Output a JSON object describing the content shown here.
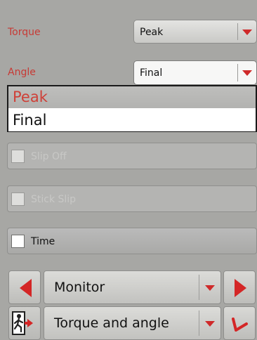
{
  "torque": {
    "label": "Torque",
    "value": "Peak"
  },
  "angle": {
    "label": "Angle",
    "value": "Final"
  },
  "angle_dropdown": {
    "options": [
      "Peak",
      "Final"
    ],
    "highlighted": "Peak"
  },
  "checkboxes": [
    {
      "label": "Slip Off",
      "checked": false,
      "enabled": false
    },
    {
      "label": "Stick Slip",
      "checked": false,
      "enabled": false
    },
    {
      "label": "Time",
      "checked": false,
      "enabled": true
    }
  ],
  "bottom_bar": {
    "mode": {
      "value": "Monitor",
      "icon": "triangle-left-right-arrows"
    },
    "selection": {
      "value": "Torque and angle",
      "exit_icon": "exit-person-icon",
      "confirm_icon": "red-checkmark-icon"
    }
  },
  "colors": {
    "accent_red": "#d42626",
    "label_red": "#c73a35",
    "background": "#a7a7a4"
  }
}
